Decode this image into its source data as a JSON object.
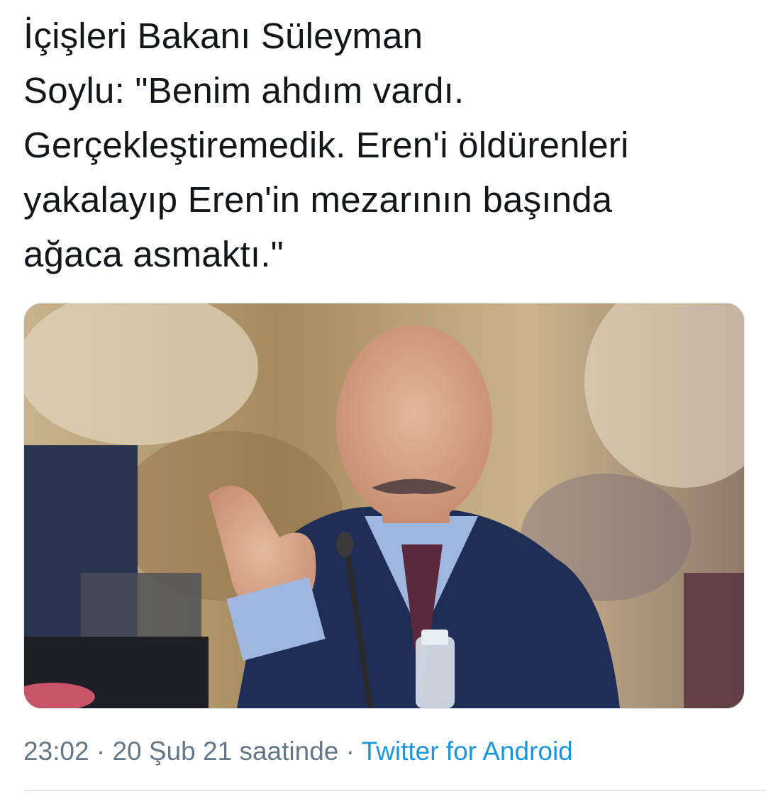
{
  "tweet": {
    "text": "İçişleri Bakanı Süleyman\nSoylu: \"Benim ahdım vardı.\nGerçekleştiremedik. Eren'i öldürenleri\nyakalayıp Eren'in mezarının başında\nağaca asmaktı.\""
  },
  "meta": {
    "timestamp": "23:02 · 20 Şub 21 saatinde",
    "separator": " · ",
    "source": "Twitter for Android"
  },
  "colors": {
    "text": "#14171a",
    "secondary": "#657786",
    "link": "#1b95e0",
    "divider": "#e1e8ed"
  }
}
